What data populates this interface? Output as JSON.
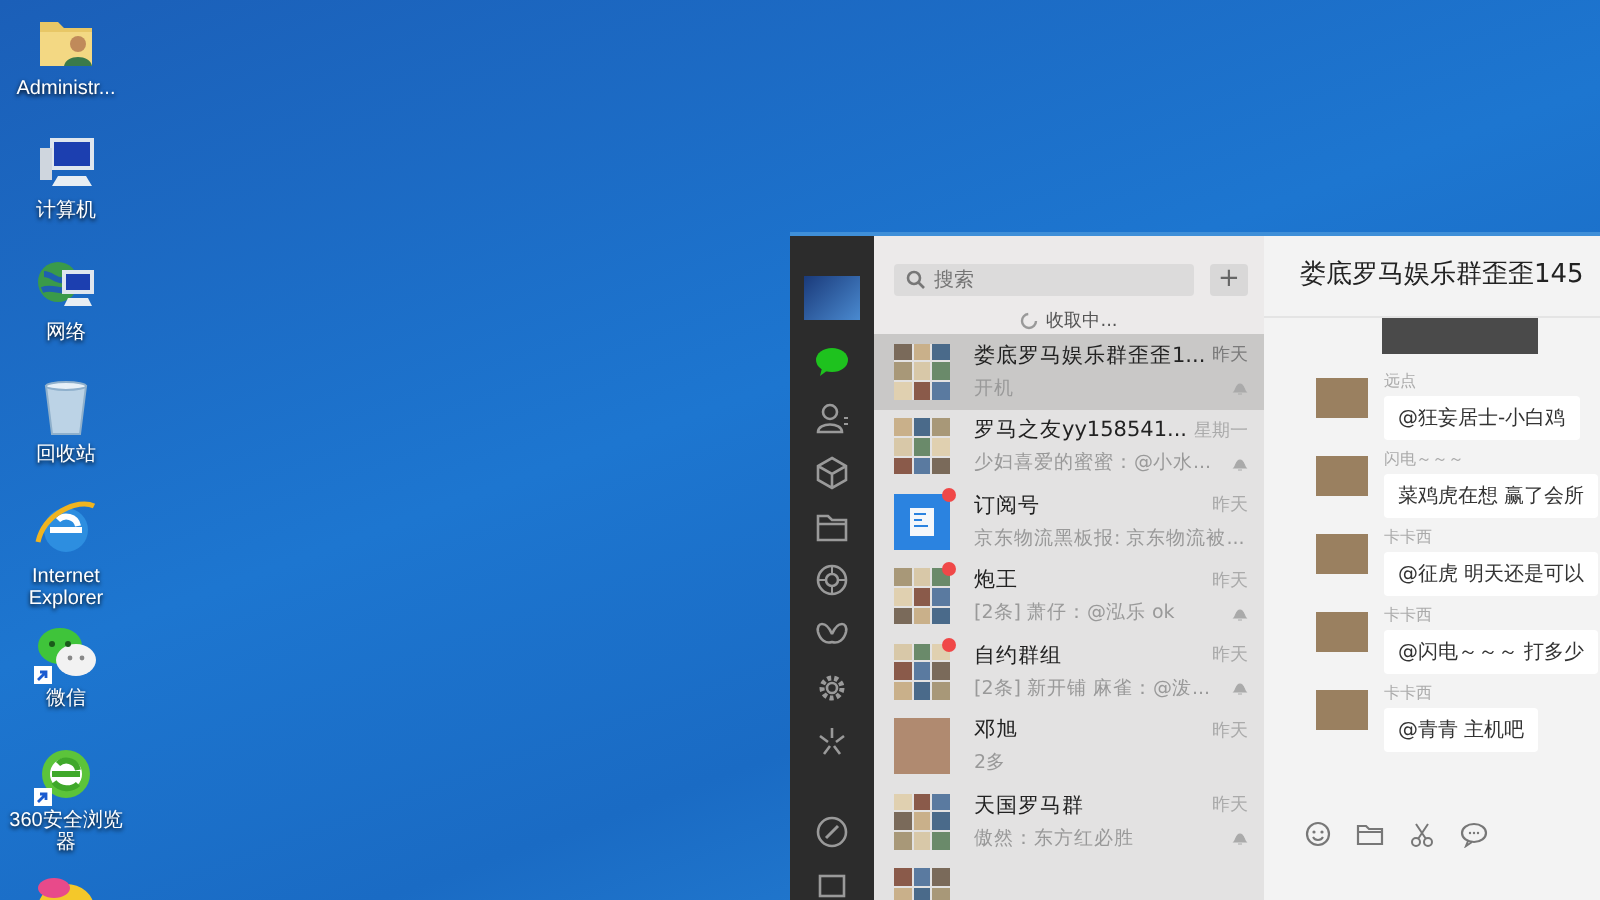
{
  "desktop_icons": [
    {
      "kind": "user-folder",
      "label": "Administr..."
    },
    {
      "kind": "computer",
      "label": "计算机"
    },
    {
      "kind": "network",
      "label": "网络"
    },
    {
      "kind": "recycle-bin",
      "label": "回收站"
    },
    {
      "kind": "ie",
      "label": "Internet Explorer",
      "shortcut": false
    },
    {
      "kind": "wechat",
      "label": "微信",
      "shortcut": true
    },
    {
      "kind": "browser360",
      "label": "360安全浏览器",
      "shortcut": true
    },
    {
      "kind": "mascot"
    }
  ],
  "wechat": {
    "sidebar": {
      "items": [
        {
          "kind": "chat",
          "selected": true
        },
        {
          "kind": "contacts",
          "selected": false
        },
        {
          "kind": "cube",
          "selected": false
        },
        {
          "kind": "folder",
          "selected": false
        },
        {
          "kind": "aperture",
          "selected": false
        },
        {
          "kind": "butterfly",
          "selected": false
        },
        {
          "kind": "gear",
          "selected": false
        },
        {
          "kind": "sparkle",
          "selected": false
        }
      ],
      "bottom_items": [
        {
          "kind": "link"
        },
        {
          "kind": "menu"
        }
      ]
    },
    "search": {
      "placeholder": "搜索",
      "add_button": "+"
    },
    "sync_status": "收取中...",
    "chats": [
      {
        "kind": "group",
        "name": "娄底罗马娱乐群歪歪1...",
        "preview": "开机",
        "time": "昨天",
        "unread": false,
        "muted": true,
        "selected": true
      },
      {
        "kind": "group",
        "name": "罗马之友yy158541...",
        "preview": "少妇喜爱的蜜蜜：@小水...",
        "time": "星期一",
        "unread": false,
        "muted": true,
        "selected": false
      },
      {
        "kind": "app",
        "name": "订阅号",
        "preview": "京东物流黑板报: 京东物流被...",
        "time": "昨天",
        "unread": true,
        "muted": false,
        "selected": false
      },
      {
        "kind": "group",
        "name": "炮王",
        "preview": "[2条] 萧仔：@泓乐 ok",
        "time": "昨天",
        "unread": true,
        "muted": true,
        "selected": false
      },
      {
        "kind": "group",
        "name": "自约群组",
        "preview": "[2条] 新开铺 麻雀：@泼...",
        "time": "昨天",
        "unread": true,
        "muted": true,
        "selected": false
      },
      {
        "kind": "photo",
        "name": "邓旭",
        "preview": "2多",
        "time": "昨天",
        "unread": false,
        "muted": false,
        "selected": false
      },
      {
        "kind": "group",
        "name": "天国罗马群",
        "preview": "傲然：东方红必胜",
        "time": "昨天",
        "unread": false,
        "muted": true,
        "selected": false
      },
      {
        "kind": "group",
        "unread": false,
        "muted": false,
        "selected": false
      }
    ],
    "conversation": {
      "title": "娄底罗马娱乐群歪歪145",
      "messages": [
        {
          "kind": "image"
        },
        {
          "kind": "text",
          "sender": "远点",
          "text": "@狂妄居士-小白鸡"
        },
        {
          "kind": "text",
          "sender": "闪电～～～",
          "text": "菜鸡虎在想 赢了会所"
        },
        {
          "kind": "text",
          "sender": "卡卡西",
          "text": "@征虎 明天还是可以"
        },
        {
          "kind": "text",
          "sender": "卡卡西",
          "text": "@闪电～～～ 打多少"
        },
        {
          "kind": "text",
          "sender": "卡卡西",
          "text": "@青青 主机吧"
        }
      ],
      "toolbar": [
        {
          "kind": "emoji"
        },
        {
          "kind": "folder"
        },
        {
          "kind": "scissors"
        },
        {
          "kind": "bubble"
        }
      ]
    }
  }
}
